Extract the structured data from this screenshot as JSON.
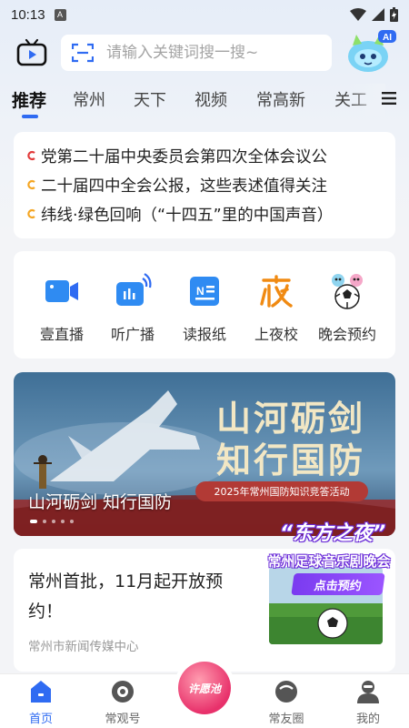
{
  "status_bar": {
    "time": "10:13",
    "indicator": "A"
  },
  "header": {
    "search_placeholder": "请输入关键词搜一搜~",
    "ai_badge": "AI"
  },
  "tabs": [
    "推荐",
    "常州",
    "天下",
    "视频",
    "常高新",
    "关工"
  ],
  "headlines": [
    "党第二十届中央委员会第四次全体会议公",
    "二十届四中全会公报，这些表述值得关注",
    "纬线·绿色回响（“十四五”里的中国声音）"
  ],
  "quick_actions": [
    {
      "label": "壹直播",
      "icon": "live-camera-icon"
    },
    {
      "label": "听广播",
      "icon": "radio-icon"
    },
    {
      "label": "读报纸",
      "icon": "newspaper-icon"
    },
    {
      "label": "上夜校",
      "icon": "night-school-icon"
    },
    {
      "label": "晚会预约",
      "icon": "gala-mascot-icon"
    }
  ],
  "banner": {
    "title_line1": "山河砺剑",
    "title_line2": "知行国防",
    "subtitle": "2025年常州国防知识竞答活动",
    "caption": "山河砺剑 知行国防"
  },
  "news": {
    "title": "常州首批，11月起开放预约！",
    "source": "常州市新闻传媒中心"
  },
  "promo": {
    "title": "“东方之夜”",
    "subtitle": "常州足球音乐剧晚会",
    "button": "点击预约"
  },
  "bottom_nav": [
    {
      "label": "首页",
      "active": true
    },
    {
      "label": "常观号",
      "active": false
    },
    {
      "label": "许愿池",
      "active": false
    },
    {
      "label": "常友圈",
      "active": false
    },
    {
      "label": "我的",
      "active": false
    }
  ],
  "colors": {
    "accent": "#2f6bf2",
    "bullet": "#f5a623",
    "bullet_first": "#e23b3b"
  }
}
